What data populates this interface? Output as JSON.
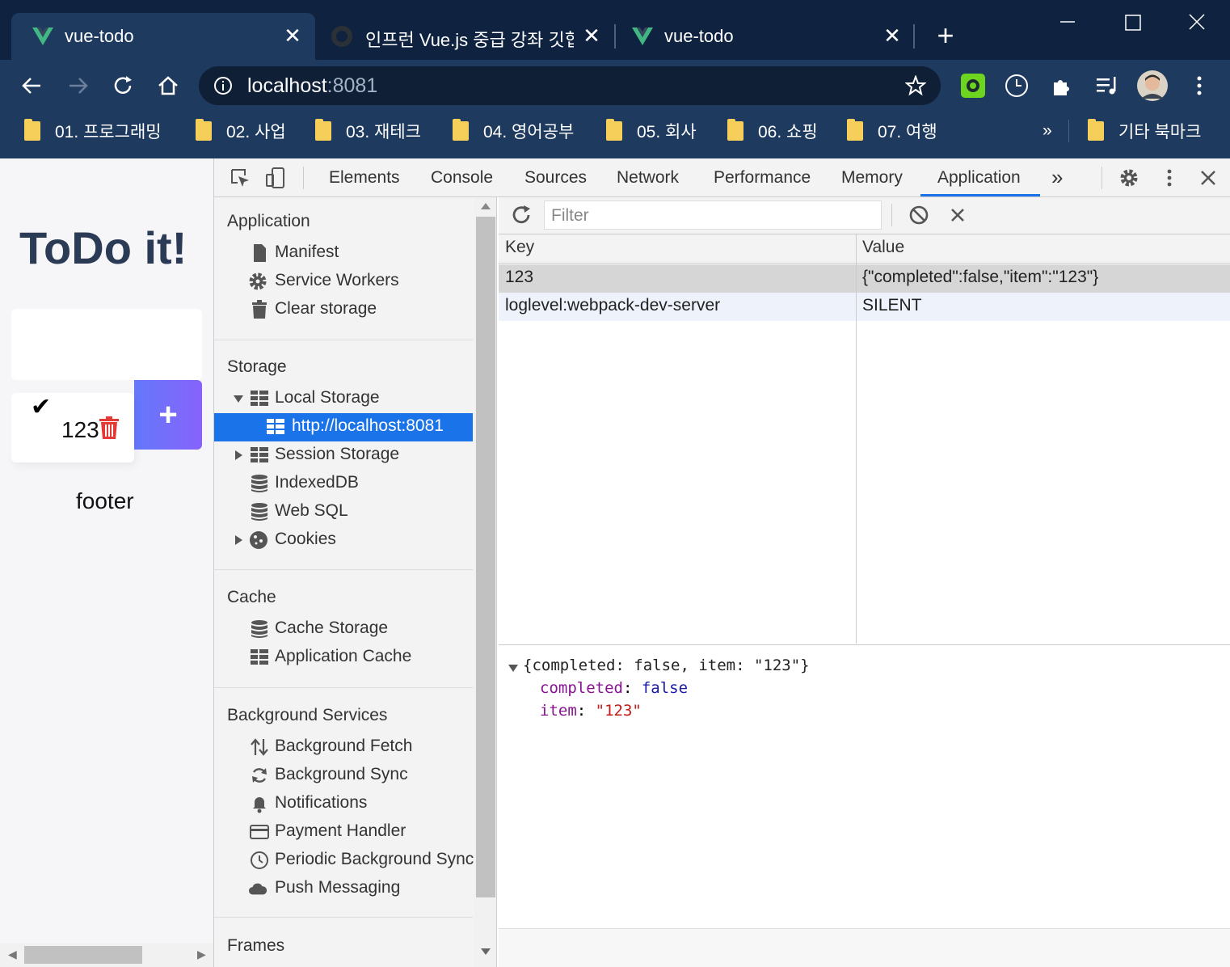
{
  "tabs": [
    {
      "title": "vue-todo",
      "active": true
    },
    {
      "title": "인프런 Vue.js 중급 강좌 깃헙",
      "active": false
    },
    {
      "title": "vue-todo",
      "active": false
    }
  ],
  "address": {
    "host": "localhost",
    "port": ":8081"
  },
  "bookmarks": [
    "01. 프로그래밍",
    "02. 사업",
    "03. 재테크",
    "04. 영어공부",
    "05. 회사",
    "06. 쇼핑",
    "07. 여행"
  ],
  "bookmarks_overflow": "»",
  "bookmarks_other": "기타 북마크",
  "app": {
    "title": "ToDo it!",
    "add_label": "+",
    "todo_text": "123",
    "footer": "footer"
  },
  "devtools": {
    "tabs": [
      "Elements",
      "Console",
      "Sources",
      "Network",
      "Performance",
      "Memory",
      "Application"
    ],
    "active_tab": "Application",
    "more": "»",
    "sidebar": {
      "application": {
        "title": "Application",
        "items": [
          "Manifest",
          "Service Workers",
          "Clear storage"
        ]
      },
      "storage": {
        "title": "Storage",
        "local_storage": "Local Storage",
        "local_origin": "http://localhost:8081",
        "items": [
          "Session Storage",
          "IndexedDB",
          "Web SQL",
          "Cookies"
        ]
      },
      "cache": {
        "title": "Cache",
        "items": [
          "Cache Storage",
          "Application Cache"
        ]
      },
      "background": {
        "title": "Background Services",
        "items": [
          "Background Fetch",
          "Background Sync",
          "Notifications",
          "Payment Handler",
          "Periodic Background Sync",
          "Push Messaging"
        ]
      },
      "frames": {
        "title": "Frames"
      }
    },
    "filter_placeholder": "Filter",
    "table": {
      "headers": {
        "key": "Key",
        "value": "Value"
      },
      "rows": [
        {
          "key": "123",
          "value": "{\"completed\":false,\"item\":\"123\"}"
        },
        {
          "key": "loglevel:webpack-dev-server",
          "value": "SILENT"
        }
      ]
    },
    "preview": {
      "summary": "{completed: false, item: \"123\"}",
      "prop1_key": "completed",
      "prop1_val": "false",
      "prop2_key": "item",
      "prop2_val": "\"123\""
    }
  }
}
